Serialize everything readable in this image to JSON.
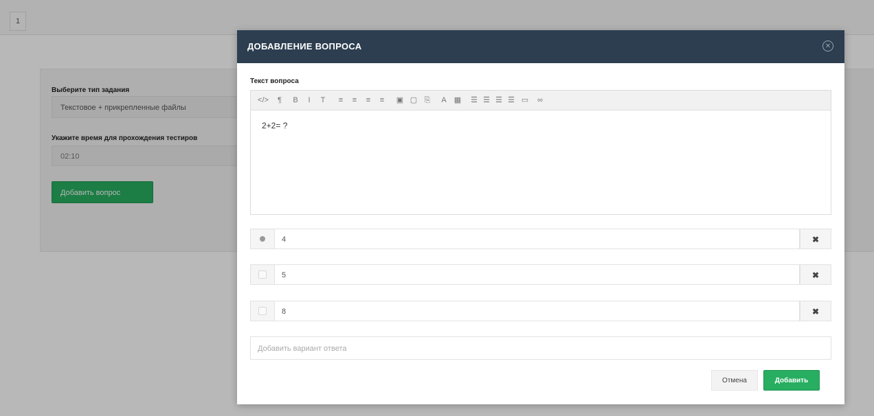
{
  "background": {
    "corner_button": "1",
    "type_label": "Выберите тип задания",
    "type_value": "Текстовое + прикрепленные файлы",
    "time_label": "Укажите время для прохождения тестиров",
    "time_value": "02:10",
    "add_question_button": "Добавить вопрос"
  },
  "modal": {
    "title": "ДОБАВЛЕНИЕ ВОПРОСА",
    "close_icon": "close-circle-icon",
    "question_label": "Текст вопроса",
    "toolbar": [
      {
        "name": "code-view-icon",
        "glyph": "</>"
      },
      {
        "name": "paragraph-icon",
        "glyph": "¶"
      },
      {
        "name": "bold-icon",
        "glyph": "B"
      },
      {
        "name": "italic-icon",
        "glyph": "I"
      },
      {
        "name": "strikethrough-icon",
        "glyph": "T"
      },
      {
        "name": "align-left-icon",
        "glyph": "≡"
      },
      {
        "name": "align-center-icon",
        "glyph": "≡"
      },
      {
        "name": "align-right-icon",
        "glyph": "≡"
      },
      {
        "name": "align-justify-icon",
        "glyph": "≡"
      },
      {
        "name": "image-icon",
        "glyph": "▣"
      },
      {
        "name": "video-icon",
        "glyph": "▢"
      },
      {
        "name": "file-icon",
        "glyph": "⎘"
      },
      {
        "name": "font-color-icon",
        "glyph": "A"
      },
      {
        "name": "table-icon",
        "glyph": "▦"
      },
      {
        "name": "unordered-list-icon",
        "glyph": "☰"
      },
      {
        "name": "ordered-list-icon",
        "glyph": "☰"
      },
      {
        "name": "outdent-icon",
        "glyph": "☰"
      },
      {
        "name": "indent-icon",
        "glyph": "☰"
      },
      {
        "name": "horizontal-rule-icon",
        "glyph": "▭"
      },
      {
        "name": "link-icon",
        "glyph": "∞"
      }
    ],
    "question_text": "2+2= ?",
    "answers": [
      {
        "value": "4",
        "checked": true
      },
      {
        "value": "5",
        "checked": false
      },
      {
        "value": "8",
        "checked": false
      }
    ],
    "delete_glyph": "✖",
    "add_answer_placeholder": "Добавить вариант ответа",
    "cancel_label": "Отмена",
    "submit_label": "Добавить"
  }
}
